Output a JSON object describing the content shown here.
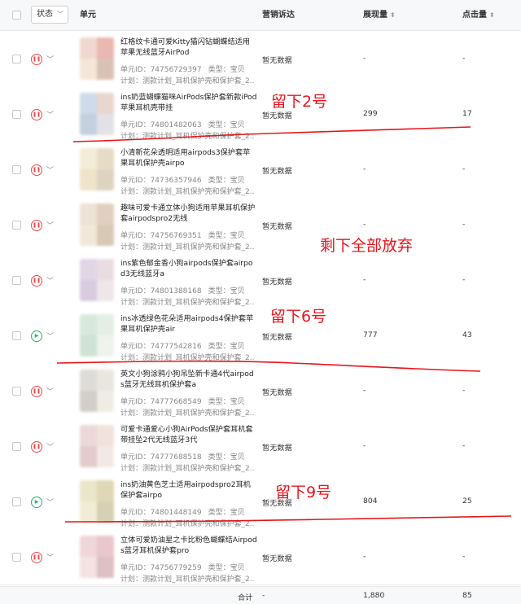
{
  "header": {
    "status_label": "状态",
    "unit_label": "单元",
    "marketing_label": "营销诉达",
    "impressions_label": "展现量",
    "clicks_label": "点击量"
  },
  "rows": [
    {
      "status": "paused",
      "title": "红格纹卡通可爱Kitty猫闪钻蝴蝶结适用苹果无线蓝牙AirPod",
      "unit_id": "单元ID：74756729397",
      "type": "类型：宝贝",
      "plan": "计划：测款计划_耳机保护壳和保护套_2...",
      "marketing": "暂无数据",
      "impressions": "-",
      "clicks": "-"
    },
    {
      "status": "paused",
      "title": "ins奶蓝蝴蝶猫咪AirPods保护套新款iPod苹果耳机壳带挂",
      "unit_id": "单元ID：74801482063",
      "type": "类型：宝贝",
      "plan": "计划：测款计划_耳机保护壳和保护套_2...",
      "marketing": "暂无数据",
      "impressions": "299",
      "clicks": "17"
    },
    {
      "status": "paused",
      "title": "小清新花朵透明适用airpods3保护套苹果耳机保护壳airpo",
      "unit_id": "单元ID：74736357946",
      "type": "类型：宝贝",
      "plan": "计划：测款计划_耳机保护壳和保护套_2...",
      "marketing": "暂无数据",
      "impressions": "-",
      "clicks": "-"
    },
    {
      "status": "paused",
      "title": "趣味可爱卡通立体小狗适用苹果耳机保护套airpodspro2无线",
      "unit_id": "单元ID：74756769351",
      "type": "类型：宝贝",
      "plan": "计划：测款计划_耳机保护壳和保护套_2...",
      "marketing": "暂无数据",
      "impressions": "-",
      "clicks": "-"
    },
    {
      "status": "paused",
      "title": "ins紫色郁金香小狗airpods保护套airpod3无线蓝牙a",
      "unit_id": "单元ID：74801388168",
      "type": "类型：宝贝",
      "plan": "计划：测款计划_耳机保护壳和保护套_2...",
      "marketing": "暂无数据",
      "impressions": "-",
      "clicks": "-"
    },
    {
      "status": "running",
      "title": "ins冰透绿色花朵适用airpods4保护套苹果耳机保护壳air",
      "unit_id": "单元ID：74777542816",
      "type": "类型：宝贝",
      "plan": "计划：测款计划_耳机保护壳和保护套_2...",
      "marketing": "暂无数据",
      "impressions": "777",
      "clicks": "43"
    },
    {
      "status": "paused",
      "title": "英文小狗涂鸦小狗吊坠新卡通4代airpods蓝牙无线耳机保护套a",
      "unit_id": "单元ID：74777668549",
      "type": "类型：宝贝",
      "plan": "计划：测款计划_耳机保护壳和保护套_2...",
      "marketing": "暂无数据",
      "impressions": "-",
      "clicks": "-"
    },
    {
      "status": "paused",
      "title": "可爱卡通爱心小狗AirPods保护套耳机套带挂坠2代无线蓝牙3代",
      "unit_id": "单元ID：74777688518",
      "type": "类型：宝贝",
      "plan": "计划：测款计划_耳机保护壳和保护套_2...",
      "marketing": "暂无数据",
      "impressions": "-",
      "clicks": "-"
    },
    {
      "status": "running",
      "title": "ins奶油黄色芝士适用airpodspro2耳机保护套airpo",
      "unit_id": "单元ID：74801448149",
      "type": "类型：宝贝",
      "plan": "计划：测款计划_耳机保护壳和保护套_2...",
      "marketing": "暂无数据",
      "impressions": "804",
      "clicks": "25"
    },
    {
      "status": "paused",
      "title": "立体可爱奶油星之卡比粉色蝴蝶结Airpods蓝牙耳机保护套pro",
      "unit_id": "单元ID：74756779259",
      "type": "类型：宝贝",
      "plan": "计划：测款计划_耳机保护壳和保护套_2...",
      "marketing": "暂无数据",
      "impressions": "-",
      "clicks": "-"
    }
  ],
  "footer": {
    "total_label": "合计",
    "marketing": "-",
    "impressions": "1,880",
    "clicks": "85"
  },
  "annotations": {
    "note_keep_2": "留下2号",
    "note_abandon_rest": "剩下全部放弃",
    "note_keep_6": "留下6号",
    "note_keep_9": "留下9号",
    "color": "#e8141c"
  },
  "colors": {
    "paused": "#e84b4b",
    "running": "#21b36a",
    "header_bg": "#f7f8fa"
  },
  "icons": {
    "paused": "pause-circle-icon",
    "running": "play-circle-icon",
    "dropdown": "chevron-down-icon",
    "sort": "sort-icon"
  }
}
